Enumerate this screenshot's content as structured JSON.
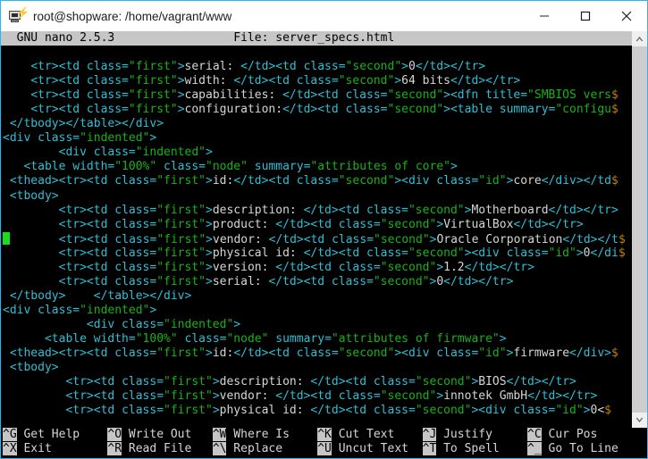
{
  "window": {
    "title": "root@shopware: /home/vagrant/www",
    "icon": "putty-terminal-icon",
    "accent_color": "#29b5f6",
    "controls": {
      "minimize": "minimize-button",
      "maximize": "maximize-button",
      "close": "close-button"
    }
  },
  "nano": {
    "version_label": "GNU nano 2.5.3",
    "file_label": "File: server_specs.html",
    "header_line": "  GNU nano 2.5.3                 File: server_specs.html",
    "cursor": {
      "line_index": 15,
      "column": 0,
      "color": "#18e018"
    }
  },
  "colors": {
    "terminal_bg": "#000000",
    "tag": "#2fbfd4",
    "attribute_value": "#18b218",
    "plain_text": "#d6d6d6",
    "continuation_marker": "#c08000",
    "header_bg": "#c6c6c6",
    "header_fg": "#000000"
  },
  "editor_lines": [
    {
      "indent": 4,
      "segments": [
        {
          "c": "tag",
          "t": "<tr><td class="
        },
        {
          "c": "attr",
          "t": "\"first\""
        },
        {
          "c": "tag",
          "t": ">"
        },
        {
          "c": "txt",
          "t": "serial: "
        },
        {
          "c": "tag",
          "t": "</td><td class="
        },
        {
          "c": "attr",
          "t": "\"second\""
        },
        {
          "c": "tag",
          "t": ">"
        },
        {
          "c": "txt",
          "t": "0"
        },
        {
          "c": "tag",
          "t": "</td></tr>"
        }
      ]
    },
    {
      "indent": 4,
      "segments": [
        {
          "c": "tag",
          "t": "<tr><td class="
        },
        {
          "c": "attr",
          "t": "\"first\""
        },
        {
          "c": "tag",
          "t": ">"
        },
        {
          "c": "txt",
          "t": "width: "
        },
        {
          "c": "tag",
          "t": "</td><td class="
        },
        {
          "c": "attr",
          "t": "\"second\""
        },
        {
          "c": "tag",
          "t": ">"
        },
        {
          "c": "txt",
          "t": "64 bits"
        },
        {
          "c": "tag",
          "t": "</td></tr>"
        }
      ]
    },
    {
      "indent": 4,
      "segments": [
        {
          "c": "tag",
          "t": "<tr><td class="
        },
        {
          "c": "attr",
          "t": "\"first\""
        },
        {
          "c": "tag",
          "t": ">"
        },
        {
          "c": "txt",
          "t": "capabilities: "
        },
        {
          "c": "tag",
          "t": "</td><td class="
        },
        {
          "c": "attr",
          "t": "\"second\""
        },
        {
          "c": "tag",
          "t": ">"
        },
        {
          "c": "tag",
          "t": "<dfn title="
        },
        {
          "c": "attr",
          "t": "\"SMBIOS vers"
        },
        {
          "c": "cont",
          "t": "$"
        }
      ]
    },
    {
      "indent": 4,
      "segments": [
        {
          "c": "tag",
          "t": "<tr><td class="
        },
        {
          "c": "attr",
          "t": "\"first\""
        },
        {
          "c": "tag",
          "t": ">"
        },
        {
          "c": "txt",
          "t": "configuration:"
        },
        {
          "c": "tag",
          "t": "</td><td class="
        },
        {
          "c": "attr",
          "t": "\"second\""
        },
        {
          "c": "tag",
          "t": ">"
        },
        {
          "c": "tag",
          "t": "<table summary="
        },
        {
          "c": "attr",
          "t": "\"configu"
        },
        {
          "c": "cont",
          "t": "$"
        }
      ]
    },
    {
      "indent": 1,
      "segments": [
        {
          "c": "tag",
          "t": "</tbody></table></div>"
        }
      ]
    },
    {
      "indent": 0,
      "segments": [
        {
          "c": "tag",
          "t": "<div class="
        },
        {
          "c": "attr",
          "t": "\"indented\""
        },
        {
          "c": "tag",
          "t": ">"
        }
      ]
    },
    {
      "indent": 8,
      "segments": [
        {
          "c": "tag",
          "t": "<div class="
        },
        {
          "c": "attr",
          "t": "\"indented\""
        },
        {
          "c": "tag",
          "t": ">"
        }
      ]
    },
    {
      "indent": 3,
      "segments": [
        {
          "c": "tag",
          "t": "<table width="
        },
        {
          "c": "attr",
          "t": "\"100%\""
        },
        {
          "c": "tag",
          "t": " class="
        },
        {
          "c": "attr",
          "t": "\"node\""
        },
        {
          "c": "tag",
          "t": " summary="
        },
        {
          "c": "attr",
          "t": "\"attributes of core\""
        },
        {
          "c": "tag",
          "t": ">"
        }
      ]
    },
    {
      "indent": 1,
      "segments": [
        {
          "c": "tag",
          "t": "<thead><tr><td class="
        },
        {
          "c": "attr",
          "t": "\"first\""
        },
        {
          "c": "tag",
          "t": ">"
        },
        {
          "c": "txt",
          "t": "id:"
        },
        {
          "c": "tag",
          "t": "</td><td class="
        },
        {
          "c": "attr",
          "t": "\"second\""
        },
        {
          "c": "tag",
          "t": ">"
        },
        {
          "c": "tag",
          "t": "<div class="
        },
        {
          "c": "attr",
          "t": "\"id\""
        },
        {
          "c": "tag",
          "t": ">"
        },
        {
          "c": "txt",
          "t": "core"
        },
        {
          "c": "tag",
          "t": "</div></td"
        },
        {
          "c": "cont",
          "t": "$"
        }
      ]
    },
    {
      "indent": 1,
      "segments": [
        {
          "c": "tag",
          "t": "<tbody>"
        }
      ]
    },
    {
      "indent": 8,
      "segments": [
        {
          "c": "tag",
          "t": "<tr><td class="
        },
        {
          "c": "attr",
          "t": "\"first\""
        },
        {
          "c": "tag",
          "t": ">"
        },
        {
          "c": "txt",
          "t": "description: "
        },
        {
          "c": "tag",
          "t": "</td><td class="
        },
        {
          "c": "attr",
          "t": "\"second\""
        },
        {
          "c": "tag",
          "t": ">"
        },
        {
          "c": "txt",
          "t": "Motherboard"
        },
        {
          "c": "tag",
          "t": "</td></tr>"
        }
      ]
    },
    {
      "indent": 8,
      "segments": [
        {
          "c": "tag",
          "t": "<tr><td class="
        },
        {
          "c": "attr",
          "t": "\"first\""
        },
        {
          "c": "tag",
          "t": ">"
        },
        {
          "c": "txt",
          "t": "product: "
        },
        {
          "c": "tag",
          "t": "</td><td class="
        },
        {
          "c": "attr",
          "t": "\"second\""
        },
        {
          "c": "tag",
          "t": ">"
        },
        {
          "c": "txt",
          "t": "VirtualBox"
        },
        {
          "c": "tag",
          "t": "</td></tr>"
        }
      ]
    },
    {
      "indent": 8,
      "cursor": true,
      "segments": [
        {
          "c": "tag",
          "t": "<tr><td class="
        },
        {
          "c": "attr",
          "t": "\"first\""
        },
        {
          "c": "tag",
          "t": ">"
        },
        {
          "c": "txt",
          "t": "vendor: "
        },
        {
          "c": "tag",
          "t": "</td><td class="
        },
        {
          "c": "attr",
          "t": "\"second\""
        },
        {
          "c": "tag",
          "t": ">"
        },
        {
          "c": "txt",
          "t": "Oracle Corporation"
        },
        {
          "c": "tag",
          "t": "</td></t"
        },
        {
          "c": "cont",
          "t": "$"
        }
      ]
    },
    {
      "indent": 8,
      "segments": [
        {
          "c": "tag",
          "t": "<tr><td class="
        },
        {
          "c": "attr",
          "t": "\"first\""
        },
        {
          "c": "tag",
          "t": ">"
        },
        {
          "c": "txt",
          "t": "physical id: "
        },
        {
          "c": "tag",
          "t": "</td><td class="
        },
        {
          "c": "attr",
          "t": "\"second\""
        },
        {
          "c": "tag",
          "t": ">"
        },
        {
          "c": "tag",
          "t": "<div class="
        },
        {
          "c": "attr",
          "t": "\"id\""
        },
        {
          "c": "tag",
          "t": ">"
        },
        {
          "c": "txt",
          "t": "0"
        },
        {
          "c": "tag",
          "t": "</di"
        },
        {
          "c": "cont",
          "t": "$"
        }
      ]
    },
    {
      "indent": 8,
      "segments": [
        {
          "c": "tag",
          "t": "<tr><td class="
        },
        {
          "c": "attr",
          "t": "\"first\""
        },
        {
          "c": "tag",
          "t": ">"
        },
        {
          "c": "txt",
          "t": "version: "
        },
        {
          "c": "tag",
          "t": "</td><td class="
        },
        {
          "c": "attr",
          "t": "\"second\""
        },
        {
          "c": "tag",
          "t": ">"
        },
        {
          "c": "txt",
          "t": "1.2"
        },
        {
          "c": "tag",
          "t": "</td></tr>"
        }
      ]
    },
    {
      "indent": 8,
      "segments": [
        {
          "c": "tag",
          "t": "<tr><td class="
        },
        {
          "c": "attr",
          "t": "\"first\""
        },
        {
          "c": "tag",
          "t": ">"
        },
        {
          "c": "txt",
          "t": "serial: "
        },
        {
          "c": "tag",
          "t": "</td><td class="
        },
        {
          "c": "attr",
          "t": "\"second\""
        },
        {
          "c": "tag",
          "t": ">"
        },
        {
          "c": "txt",
          "t": "0"
        },
        {
          "c": "tag",
          "t": "</td></tr>"
        }
      ]
    },
    {
      "indent": 1,
      "segments": [
        {
          "c": "tag",
          "t": "</tbody>    </table></div>"
        }
      ]
    },
    {
      "indent": 0,
      "segments": [
        {
          "c": "tag",
          "t": "<div class="
        },
        {
          "c": "attr",
          "t": "\"indented\""
        },
        {
          "c": "tag",
          "t": ">"
        }
      ]
    },
    {
      "indent": 12,
      "segments": [
        {
          "c": "tag",
          "t": "<div class="
        },
        {
          "c": "attr",
          "t": "\"indented\""
        },
        {
          "c": "tag",
          "t": ">"
        }
      ]
    },
    {
      "indent": 6,
      "segments": [
        {
          "c": "tag",
          "t": "<table width="
        },
        {
          "c": "attr",
          "t": "\"100%\""
        },
        {
          "c": "tag",
          "t": " class="
        },
        {
          "c": "attr",
          "t": "\"node\""
        },
        {
          "c": "tag",
          "t": " summary="
        },
        {
          "c": "attr",
          "t": "\"attributes of firmware\""
        },
        {
          "c": "tag",
          "t": ">"
        }
      ]
    },
    {
      "indent": 1,
      "segments": [
        {
          "c": "tag",
          "t": "<thead><tr><td class="
        },
        {
          "c": "attr",
          "t": "\"first\""
        },
        {
          "c": "tag",
          "t": ">"
        },
        {
          "c": "txt",
          "t": "id:"
        },
        {
          "c": "tag",
          "t": "</td><td class="
        },
        {
          "c": "attr",
          "t": "\"second\""
        },
        {
          "c": "tag",
          "t": ">"
        },
        {
          "c": "tag",
          "t": "<div class="
        },
        {
          "c": "attr",
          "t": "\"id\""
        },
        {
          "c": "tag",
          "t": ">"
        },
        {
          "c": "txt",
          "t": "firmware"
        },
        {
          "c": "tag",
          "t": "</div>"
        },
        {
          "c": "cont",
          "t": "$"
        }
      ]
    },
    {
      "indent": 1,
      "segments": [
        {
          "c": "tag",
          "t": "<tbody>"
        }
      ]
    },
    {
      "indent": 9,
      "segments": [
        {
          "c": "tag",
          "t": "<tr><td class="
        },
        {
          "c": "attr",
          "t": "\"first\""
        },
        {
          "c": "tag",
          "t": ">"
        },
        {
          "c": "txt",
          "t": "description: "
        },
        {
          "c": "tag",
          "t": "</td><td class="
        },
        {
          "c": "attr",
          "t": "\"second\""
        },
        {
          "c": "tag",
          "t": ">"
        },
        {
          "c": "txt",
          "t": "BIOS"
        },
        {
          "c": "tag",
          "t": "</td></tr>"
        }
      ]
    },
    {
      "indent": 9,
      "segments": [
        {
          "c": "tag",
          "t": "<tr><td class="
        },
        {
          "c": "attr",
          "t": "\"first\""
        },
        {
          "c": "tag",
          "t": ">"
        },
        {
          "c": "txt",
          "t": "vendor: "
        },
        {
          "c": "tag",
          "t": "</td><td class="
        },
        {
          "c": "attr",
          "t": "\"second\""
        },
        {
          "c": "tag",
          "t": ">"
        },
        {
          "c": "txt",
          "t": "innotek GmbH"
        },
        {
          "c": "tag",
          "t": "</td></tr>"
        }
      ]
    },
    {
      "indent": 9,
      "segments": [
        {
          "c": "tag",
          "t": "<tr><td class="
        },
        {
          "c": "attr",
          "t": "\"first\""
        },
        {
          "c": "tag",
          "t": ">"
        },
        {
          "c": "txt",
          "t": "physical id: "
        },
        {
          "c": "tag",
          "t": "</td><td class="
        },
        {
          "c": "attr",
          "t": "\"second\""
        },
        {
          "c": "tag",
          "t": ">"
        },
        {
          "c": "tag",
          "t": "<div class="
        },
        {
          "c": "attr",
          "t": "\"id\""
        },
        {
          "c": "tag",
          "t": ">"
        },
        {
          "c": "txt",
          "t": "0<"
        },
        {
          "c": "cont",
          "t": "$"
        }
      ]
    }
  ],
  "help_bar": {
    "row1": [
      {
        "key": "^G",
        "label": "Get Help"
      },
      {
        "key": "^O",
        "label": "Write Out"
      },
      {
        "key": "^W",
        "label": "Where Is"
      },
      {
        "key": "^K",
        "label": "Cut Text"
      },
      {
        "key": "^J",
        "label": "Justify"
      },
      {
        "key": "^C",
        "label": "Cur Pos"
      }
    ],
    "row2": [
      {
        "key": "^X",
        "label": "Exit"
      },
      {
        "key": "^R",
        "label": "Read File"
      },
      {
        "key": "^\\",
        "label": "Replace"
      },
      {
        "key": "^U",
        "label": "Uncut Text"
      },
      {
        "key": "^T",
        "label": "To Spell"
      },
      {
        "key": "^_",
        "label": "Go To Line"
      }
    ]
  },
  "scrollbar": {
    "up_arrow": "scroll-up-arrow-icon",
    "down_arrow": "scroll-down-arrow-icon",
    "thumb_top_pct": 0,
    "thumb_height_pct": 100
  }
}
